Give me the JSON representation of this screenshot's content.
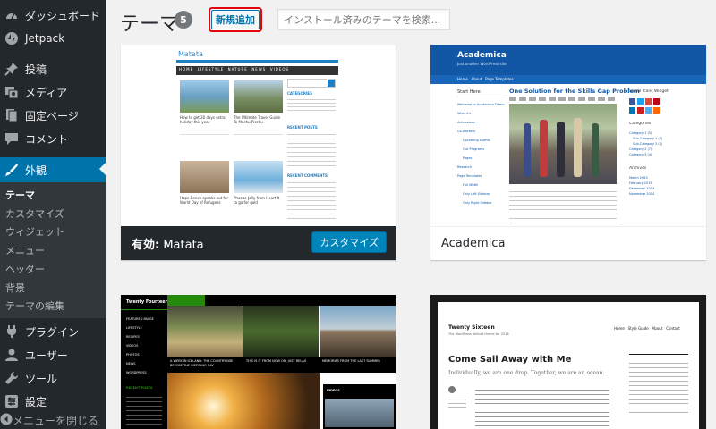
{
  "sidebar": {
    "items": [
      {
        "label": "ダッシュボード",
        "icon": "dashboard-icon"
      },
      {
        "label": "Jetpack",
        "icon": "jetpack-icon"
      },
      {
        "label": "投稿",
        "icon": "pin-icon"
      },
      {
        "label": "メディア",
        "icon": "media-icon"
      },
      {
        "label": "固定ページ",
        "icon": "page-icon"
      },
      {
        "label": "コメント",
        "icon": "comment-icon"
      },
      {
        "label": "外観",
        "icon": "brush-icon"
      },
      {
        "label": "プラグイン",
        "icon": "plugin-icon"
      },
      {
        "label": "ユーザー",
        "icon": "user-icon"
      },
      {
        "label": "ツール",
        "icon": "wrench-icon"
      },
      {
        "label": "設定",
        "icon": "settings-icon"
      }
    ],
    "submenu": [
      "テーマ",
      "カスタマイズ",
      "ウィジェット",
      "メニュー",
      "ヘッダー",
      "背景",
      "テーマの編集"
    ],
    "collapse_label": "メニューを閉じる"
  },
  "header": {
    "title": "テーマ",
    "count": "5",
    "add_new": "新規追加",
    "search_placeholder": "インストール済みのテーマを検索..."
  },
  "themes": [
    {
      "name": "Matata",
      "active_prefix": "有効:",
      "customize_label": "カスタマイズ",
      "preview": {
        "site_title": "Matata",
        "nav": [
          "HOME",
          "LIFESTYLE",
          "NATURE",
          "NEWS",
          "VIDEOS"
        ],
        "posts": [
          "How to get 20 days extra holiday this year",
          "The Ultimate Travel Guide To Machu Picchu",
          "Hope Bench speaks out for World Day of Refugees",
          "Phoebe Jolly from Heart It to go for gold"
        ],
        "widget_titles": [
          "CATEGORIES",
          "RECENT POSTS",
          "RECENT COMMENTS"
        ]
      }
    },
    {
      "name": "Academica",
      "preview": {
        "site_title": "Academica",
        "tagline": "Just another WordPress site",
        "nav": [
          "Home",
          "About",
          "Page Templates"
        ],
        "sidebar_title": "Start Here",
        "links": [
          "Welcome to Academica Demo",
          "What it's",
          "Admissions",
          "Co-Workers",
          "Upcoming Events",
          "Our Programs",
          "Pages",
          "Research",
          "Page Templates",
          "Full Width",
          "Only Left Sidebar",
          "Only Right Sidebar"
        ],
        "headline": "One Solution for the Skills Gap Problem",
        "right_titles": [
          "Social Icons Widget",
          "Categories",
          "Archives"
        ],
        "categories": [
          "Category 1 (5)",
          "Sub-Category 1 (3)",
          "Sub-Category 2 (1)",
          "Category 2 (7)",
          "Category 3 (4)"
        ],
        "archives": [
          "March 2015",
          "February 2015",
          "December 2014",
          "November 2014"
        ]
      }
    },
    {
      "name": "Twenty Fourteen",
      "preview": {
        "site_title": "Twenty Fourteen",
        "side_menu": [
          "FEATURED IMAGE",
          "LIFESTYLE",
          "RECIPES",
          "VIDEOS",
          "PHOTOS",
          "NEWS",
          "WORDPRESS"
        ],
        "posts": [
          "A WEEK IN ICELAND: THE COUNTRYSIDE BEFORE THE WEDDING DAY",
          "THIS IS IT FROM NOW ON. JUST RELAX",
          "MEMORIES FROM THE LAST SUMMER"
        ],
        "label": "VIDEOS",
        "recent_title": "RECENT POSTS"
      }
    },
    {
      "name": "Twenty Sixteen",
      "preview": {
        "site_title": "Twenty Sixteen",
        "tagline": "The WordPress default theme for 2016",
        "nav": [
          "Home",
          "Style Guide",
          "About",
          "Contact"
        ],
        "post_title": "Come Sail Away with Me",
        "post_subtitle": "Individually, we are one drop. Together, we are an ocean."
      }
    }
  ]
}
